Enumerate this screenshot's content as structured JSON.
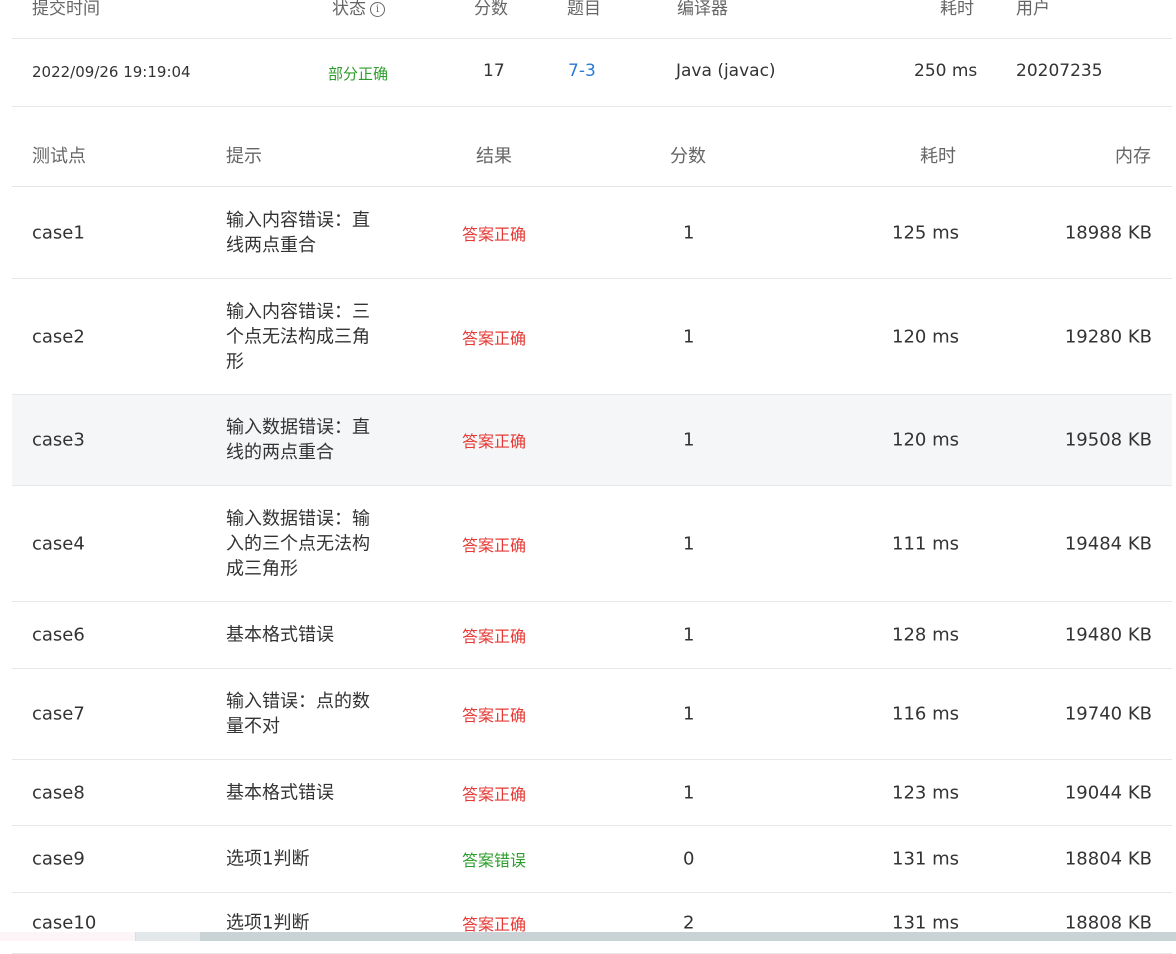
{
  "submission": {
    "headers": {
      "time": "提交时间",
      "status": "状态",
      "score": "分数",
      "problem": "题目",
      "compiler": "编译器",
      "elapsed": "耗时",
      "user": "用户"
    },
    "row": {
      "time": "2022/09/26 19:19:04",
      "status": "部分正确",
      "score": "17",
      "problem": "7-3",
      "compiler": "Java (javac)",
      "elapsed": "250 ms",
      "user": "20207235"
    },
    "colors": {
      "status": "#2e9d2e",
      "problem_link": "#2a7ad6"
    }
  },
  "cases": {
    "headers": {
      "case": "测试点",
      "hint": "提示",
      "result": "结果",
      "score": "分数",
      "time": "耗时",
      "memory": "内存"
    },
    "rows": [
      {
        "case": "case1",
        "hint": "输入内容错误：直线两点重合",
        "result": "答案正确",
        "score": "1",
        "time": "125 ms",
        "memory": "18988 KB"
      },
      {
        "case": "case2",
        "hint": "输入内容错误：三个点无法构成三角形",
        "result": "答案正确",
        "score": "1",
        "time": "120 ms",
        "memory": "19280 KB"
      },
      {
        "case": "case3",
        "hint": "输入数据错误：直线的两点重合",
        "result": "答案正确",
        "score": "1",
        "time": "120 ms",
        "memory": "19508 KB"
      },
      {
        "case": "case4",
        "hint": "输入数据错误：输入的三个点无法构成三角形",
        "result": "答案正确",
        "score": "1",
        "time": "111 ms",
        "memory": "19484 KB"
      },
      {
        "case": "case6",
        "hint": "基本格式错误",
        "result": "答案正确",
        "score": "1",
        "time": "128 ms",
        "memory": "19480 KB"
      },
      {
        "case": "case7",
        "hint": "输入错误：点的数量不对",
        "result": "答案正确",
        "score": "1",
        "time": "116 ms",
        "memory": "19740 KB"
      },
      {
        "case": "case8",
        "hint": "基本格式错误",
        "result": "答案正确",
        "score": "1",
        "time": "123 ms",
        "memory": "19044 KB"
      },
      {
        "case": "case9",
        "hint": "选项1判断",
        "result": "答案错误",
        "score": "0",
        "time": "131 ms",
        "memory": "18804 KB"
      },
      {
        "case": "case10",
        "hint": "选项1判断",
        "result": "答案正确",
        "score": "2",
        "time": "131 ms",
        "memory": "18808 KB"
      }
    ],
    "colors": {
      "correct": "#e53935",
      "wrong": "#2e9d2e",
      "hover_row": "#f5f6f8"
    }
  }
}
